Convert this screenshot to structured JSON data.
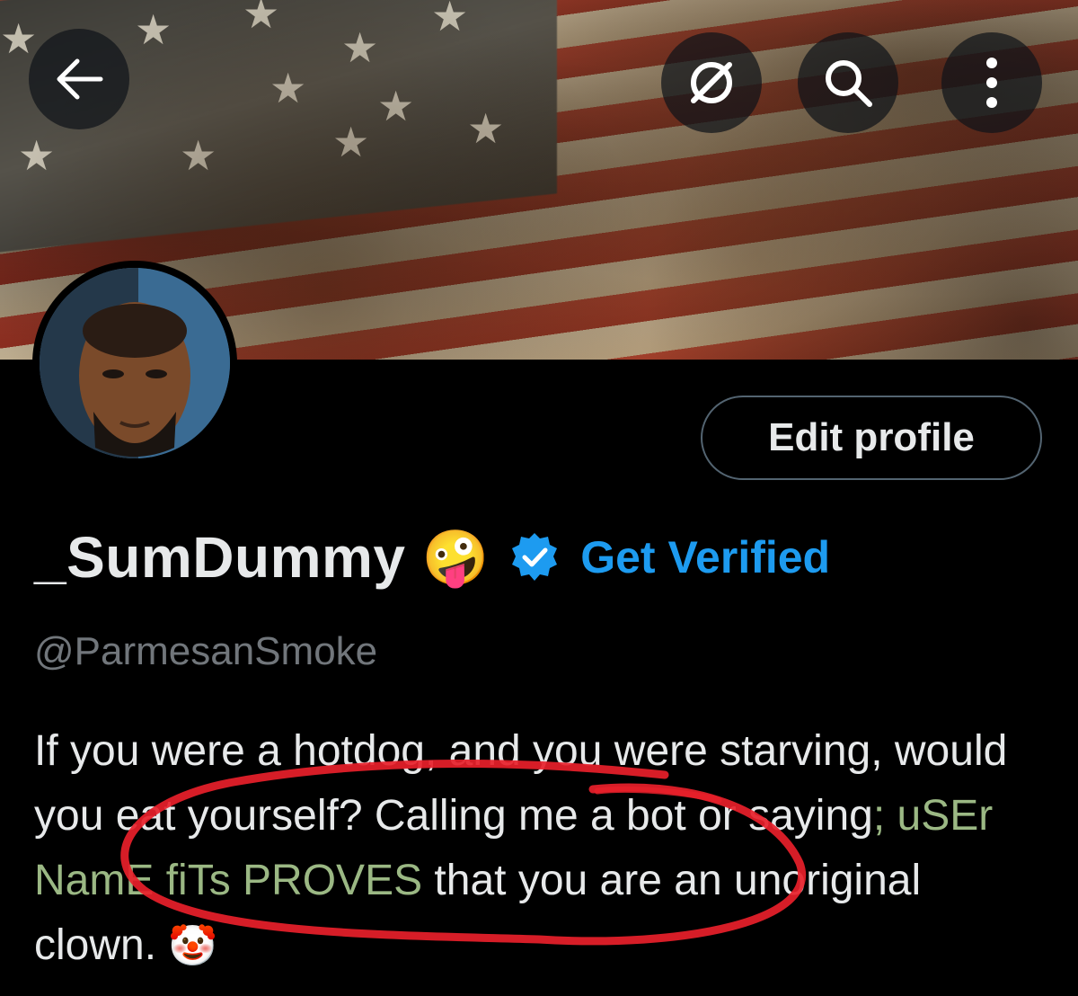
{
  "header": {
    "back_icon": "arrow-left-icon",
    "grok_icon": "grok-slash-icon",
    "search_icon": "search-icon",
    "more_icon": "more-vertical-icon"
  },
  "banner": {
    "description_icon": "american-flag-banner"
  },
  "profile": {
    "edit_profile_label": "Edit profile",
    "display_name": "_SumDummy",
    "name_emoji": "🤪",
    "verified_icon": "verified-badge-icon",
    "get_verified_label": "Get Verified",
    "handle": "@ParmesanSmoke",
    "bio": {
      "part1": "If you were a hotdog, and you were starving, would you eat yourself?  Calling me a bot or saying",
      "part2_green": "; uSEr NamE fiTs PROVES",
      "part3": " that you are an unoriginal clown. ",
      "clown_emoji": "🤡"
    }
  },
  "colors": {
    "background": "#000000",
    "text": "#e7e9ea",
    "muted": "#71767b",
    "accent": "#1d9bf0",
    "bio_highlight": "#9bb884",
    "annotation": "#e8202a"
  }
}
